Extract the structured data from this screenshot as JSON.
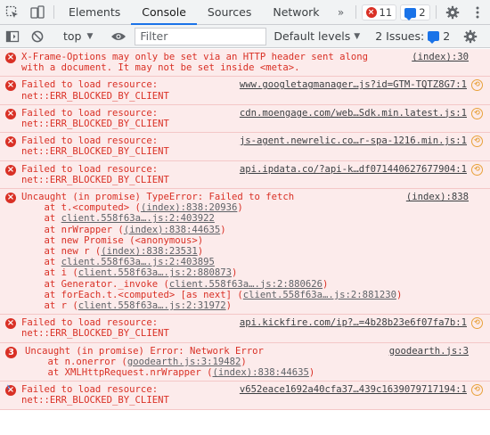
{
  "tabbar": {
    "tabs": [
      {
        "label": "Elements",
        "active": false
      },
      {
        "label": "Console",
        "active": true
      },
      {
        "label": "Sources",
        "active": false
      },
      {
        "label": "Network",
        "active": false
      }
    ],
    "more": "»",
    "errors_count": "11",
    "messages_count": "2"
  },
  "toolbar": {
    "context": "top",
    "filter_placeholder": "Filter",
    "levels": "Default levels",
    "issues_label": "2 Issues:",
    "issues_count": "2"
  },
  "messages": [
    {
      "text": "X-Frame-Options may only be set via an HTTP header sent along\nwith a document. It may not be set inside <meta>.",
      "src": "(index):30"
    },
    {
      "text": "Failed to load resource:\nnet::ERR_BLOCKED_BY_CLIENT",
      "src": "www.googletagmanager…js?id=GTM-TQTZ8G7:1"
    },
    {
      "text": "Failed to load resource:\nnet::ERR_BLOCKED_BY_CLIENT",
      "src": "cdn.moengage.com/web…Sdk.min.latest.js:1"
    },
    {
      "text": "Failed to load resource:\nnet::ERR_BLOCKED_BY_CLIENT",
      "src": "js-agent.newrelic.co…r-spa-1216.min.js:1"
    },
    {
      "text": "Failed to load resource:\nnet::ERR_BLOCKED_BY_CLIENT",
      "src": "api.ipdata.co/?api-k…df071440627677904:1"
    },
    {
      "text": "Uncaught (in promise) TypeError: Failed to fetch",
      "src": "(index):838",
      "trace": [
        {
          "pre": "    at t.<computed> (",
          "link": "(index):838:20936",
          "post": ")"
        },
        {
          "pre": "    at ",
          "link": "client.558f63a….js:2:403922",
          "post": ""
        },
        {
          "pre": "    at nrWrapper (",
          "link": "(index):838:44635",
          "post": ")"
        },
        {
          "pre": "    at new Promise (<anonymous>)",
          "link": "",
          "post": ""
        },
        {
          "pre": "    at new r (",
          "link": "(index):838:23531",
          "post": ")"
        },
        {
          "pre": "    at ",
          "link": "client.558f63a….js:2:403895",
          "post": ""
        },
        {
          "pre": "    at i (",
          "link": "client.558f63a….js:2:880873",
          "post": ")"
        },
        {
          "pre": "    at Generator._invoke (",
          "link": "client.558f63a….js:2:880626",
          "post": ")"
        },
        {
          "pre": "    at forEach.t.<computed> [as next] (",
          "link": "client.558f63a….js:2:881230",
          "post": ")"
        },
        {
          "pre": "    at r (",
          "link": "client.558f63a….js:2:31972",
          "post": ")"
        }
      ]
    },
    {
      "text": "Failed to load resource:\nnet::ERR_BLOCKED_BY_CLIENT",
      "src": "api.kickfire.com/ip?…=4b28b23e6f07fa7b:1"
    },
    {
      "text": "Uncaught (in promise) Error: Network Error",
      "src": "goodearth.js:3",
      "count": "3",
      "trace": [
        {
          "pre": "    at n.onerror (",
          "link": "goodearth.js:3:19482",
          "post": ")"
        },
        {
          "pre": "    at XMLHttpRequest.nrWrapper (",
          "link": "(index):838:44635",
          "post": ")"
        }
      ]
    },
    {
      "text": "Failed to load resource:\nnet::ERR_BLOCKED_BY_CLIENT",
      "src": "v652eace1692a40cfa37…439c1639079717194:1"
    }
  ],
  "prompt": "›",
  "colors": {
    "error": "#d93025",
    "error_bg": "#fcebeb",
    "accent": "#1a73e8"
  }
}
